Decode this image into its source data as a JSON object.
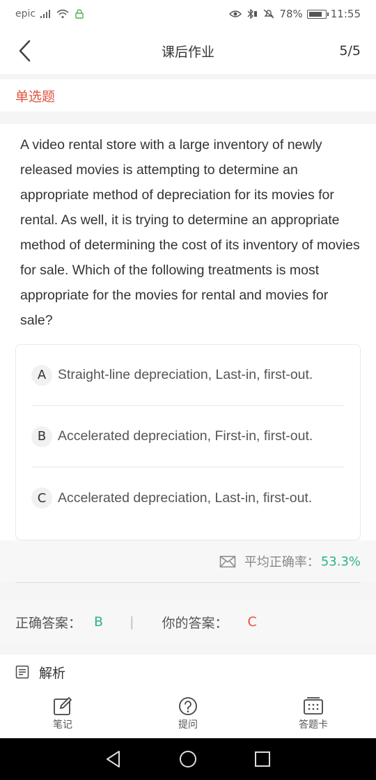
{
  "status_bar": {
    "carrier": "epic",
    "battery_percent": "78%",
    "time": "11:55"
  },
  "header": {
    "title": "课后作业",
    "progress": "5/5"
  },
  "question": {
    "type": "单选题",
    "text": "A video rental store with a large inventory of newly released movies is attempting to determine an appropriate method of depreciation for its movies for rental. As well, it is trying to determine an appropriate method of determining the cost of its inventory of movies for sale. Which of the following treatments is most appropriate for the movies for rental and movies for sale?",
    "options": [
      {
        "letter": "A",
        "text": "Straight-line depreciation, Last-in, first-out."
      },
      {
        "letter": "B",
        "text": "Accelerated depreciation, First-in, first-out."
      },
      {
        "letter": "C",
        "text": "Accelerated depreciation, Last-in, first-out."
      }
    ]
  },
  "stats": {
    "accuracy_label": "平均正确率：",
    "accuracy_value": "53.3%"
  },
  "answers": {
    "correct_label": "正确答案：",
    "correct_value": "B",
    "separator": "|",
    "yours_label": "你的答案：",
    "yours_value": "C"
  },
  "analysis": {
    "label": "解析"
  },
  "tabs": [
    {
      "label": "笔记",
      "icon": "note-edit-icon"
    },
    {
      "label": "提问",
      "icon": "question-icon"
    },
    {
      "label": "答题卡",
      "icon": "answer-card-icon"
    }
  ],
  "colors": {
    "accent_red": "#e0533f",
    "accent_green": "#2bb38a"
  }
}
